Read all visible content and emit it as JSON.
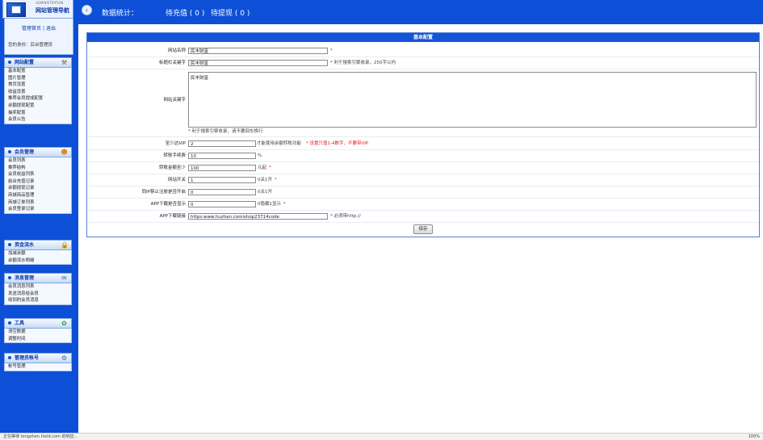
{
  "header": {
    "logo_small": "ADMINISTRATION",
    "logo_title": "网站管理导航",
    "back_icon": "circle-arrow-left-icon",
    "stats_title": "数据统计：",
    "pending_recharge": "待充值 ( 0 )",
    "pending_withdraw": "待提现 ( 0 )"
  },
  "sidebar": {
    "user_links": {
      "home": "管理首页",
      "divider": "|",
      "logout": "退出"
    },
    "identity": "您的身份：后台管理员",
    "groups": [
      {
        "title": "网站配置",
        "icon": "tools-icon",
        "items": [
          "基本配置",
          "图片管理",
          "首页设置",
          "收益设置",
          "推荐会员提成配置",
          "余额提现配置",
          "抽奖配置",
          "会员公告"
        ]
      },
      {
        "title": "会员管理",
        "icon": "users-icon",
        "items": [
          "会员列表",
          "推荐结构",
          "会员收益列表",
          "前台充值记录",
          "余额提现记录",
          "商城商品管理",
          "商城订单列表",
          "会员登录记录"
        ]
      },
      {
        "title": "资金流水",
        "icon": "lock-icon",
        "items": [
          "加减余额",
          "余额流水明细"
        ]
      },
      {
        "title": "消息管理",
        "icon": "message-icon",
        "items": [
          "会员消息列表",
          "发送消息给会员",
          "收到的会员消息"
        ]
      },
      {
        "title": "工具",
        "icon": "palette-icon",
        "items": [
          "清空数据",
          "调整时间"
        ]
      },
      {
        "title": "管理员帐号",
        "icon": "admin-icon",
        "items": [
          "帐号管理"
        ]
      }
    ]
  },
  "form": {
    "title": "基本配置",
    "site_name": {
      "label": "网站名称",
      "value": "民丰财富",
      "required": "*"
    },
    "title_keywords": {
      "label": "标题栏关键字",
      "value": "民丰财富",
      "note": "* 利于搜索引擎收录，250字以内"
    },
    "site_keywords": {
      "label": "网站关键字",
      "value": "民丰财富",
      "note": "* 利于搜索引擎收录，请不要回车换行"
    },
    "min_vip": {
      "label": "至少达VIP",
      "value": "2",
      "note_gray": "才能使用余额转账功能",
      "note_red": "* 设置只值1-4数字，不要带VIP"
    },
    "transfer_fee": {
      "label": "转账手续费",
      "value": "10",
      "unit": "%"
    },
    "min_transfer": {
      "label": "转账金额至少",
      "value": "100",
      "unit": "元起",
      "required": "*"
    },
    "site_switch": {
      "label": "网站开关",
      "value": "1",
      "unit": "0关1开",
      "required": "*"
    },
    "ip_limit": {
      "label": "同IP禁止注册是否开启",
      "value": "0",
      "unit": "0关1开"
    },
    "app_download_show": {
      "label": "APP下载是否显示",
      "value": "0",
      "unit": "0隐藏1显示",
      "required": "*"
    },
    "app_download_link": {
      "label": "APP下载链接",
      "value": "https:www.huzhan.comishop23714code",
      "note": "* 必须带http://"
    },
    "save_label": "保存"
  },
  "statusbar": {
    "left": "正在等待 tongzhen.hlxld.com 的响应...",
    "right": "100%"
  }
}
